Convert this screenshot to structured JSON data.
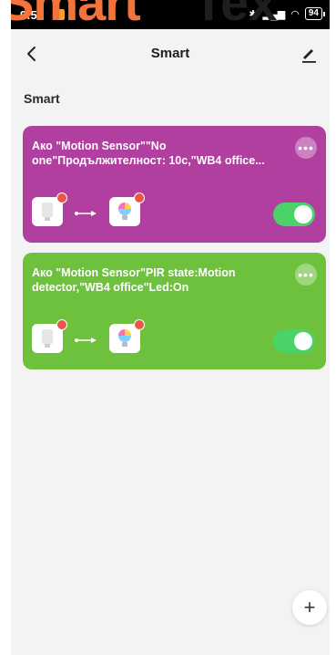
{
  "status": {
    "time": "9:53",
    "battery": "94"
  },
  "header": {
    "title": "Smart"
  },
  "section": {
    "title": "Smart"
  },
  "watermark": {
    "part1": "Smart",
    "part2": "Tex"
  },
  "scenes": [
    {
      "text": "Ако \"Motion Sensor\"\"No one\"Продължителност: 10с,\"WB4 office...",
      "enabled": true,
      "color": "#b03fa0"
    },
    {
      "text": "Ако \"Motion Sensor\"PIR state:Motion detector,\"WB4 office\"Led:On",
      "enabled": true,
      "color": "#6ec13c"
    }
  ],
  "colors": {
    "toggle_on": "#4bd36a",
    "badge": "#e8574a",
    "accent": "#f4733a"
  },
  "icons": [
    "back-arrow-icon",
    "edit-pencil-icon",
    "more-icon",
    "motion-sensor-icon",
    "smart-bulb-icon",
    "link-arrow-icon",
    "plus-icon"
  ]
}
